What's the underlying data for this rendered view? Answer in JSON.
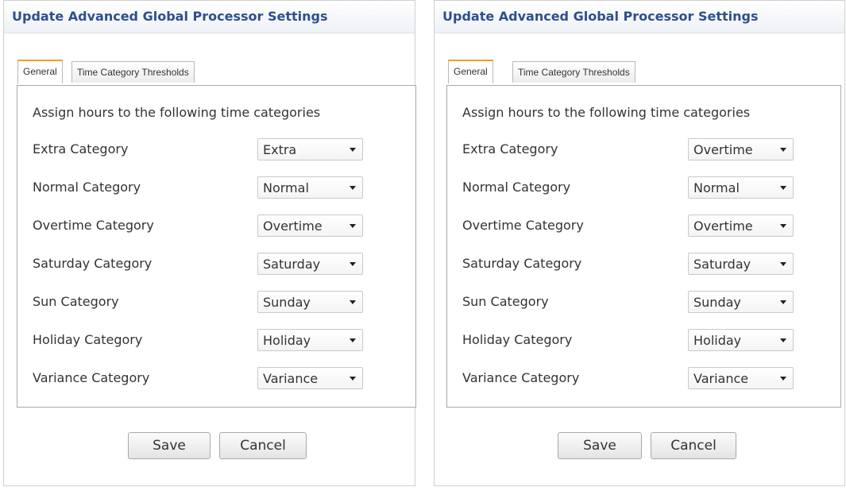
{
  "panels": [
    {
      "title": "Update Advanced Global Processor Settings",
      "tabs": [
        {
          "label": "General",
          "active": true
        },
        {
          "label": "Time Category Thresholds",
          "active": false
        }
      ],
      "intro": "Assign hours to the following time categories",
      "rows": [
        {
          "label": "Extra Category",
          "value": "Extra"
        },
        {
          "label": "Normal Category",
          "value": "Normal"
        },
        {
          "label": "Overtime Category",
          "value": "Overtime"
        },
        {
          "label": "Saturday Category",
          "value": "Saturday"
        },
        {
          "label": "Sun Category",
          "value": "Sunday"
        },
        {
          "label": "Holiday Category",
          "value": "Holiday"
        },
        {
          "label": "Variance Category",
          "value": "Variance"
        }
      ],
      "save_label": "Save",
      "cancel_label": "Cancel"
    },
    {
      "title": "Update Advanced Global Processor Settings",
      "tabs": [
        {
          "label": "General",
          "active": true
        },
        {
          "label": "Time Category Thresholds",
          "active": false
        }
      ],
      "intro": "Assign hours to the following time categories",
      "rows": [
        {
          "label": "Extra Category",
          "value": "Overtime"
        },
        {
          "label": "Normal Category",
          "value": "Normal"
        },
        {
          "label": "Overtime Category",
          "value": "Overtime"
        },
        {
          "label": "Saturday Category",
          "value": "Saturday"
        },
        {
          "label": "Sun Category",
          "value": "Sunday"
        },
        {
          "label": "Holiday Category",
          "value": "Holiday"
        },
        {
          "label": "Variance Category",
          "value": "Variance"
        }
      ],
      "save_label": "Save",
      "cancel_label": "Cancel"
    }
  ],
  "icons": {
    "dropdown": "chevron-down-icon"
  },
  "colors": {
    "title": "#2d4f8e",
    "active_tab_accent": "#f0a020"
  }
}
